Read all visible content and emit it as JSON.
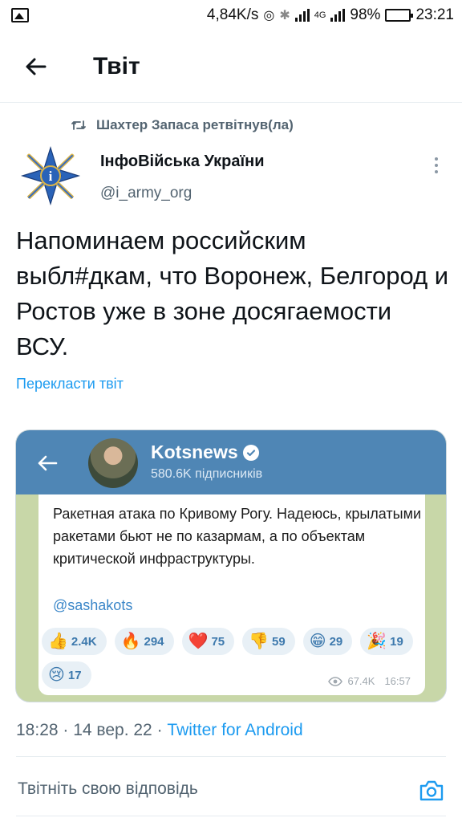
{
  "status_bar": {
    "speed": "4,84K/s",
    "network": "4G",
    "battery": "98%",
    "time": "23:21"
  },
  "header": {
    "title": "Твіт"
  },
  "tweet": {
    "retweet_text": "Шахтер Запаса ретвітнув(ла)",
    "author_name": "ІнфоВійська України",
    "author_handle": "@i_army_org",
    "text": "Напоминаем российским выбл#дкам, что Воронеж, Белгород и Ростов уже в зоне досягаемости ВСУ.",
    "translate_label": "Перекласти твіт",
    "time": "18:28",
    "date": "14 вер. 22",
    "source": "Twitter for Android"
  },
  "media": {
    "channel_name": "Kotsnews",
    "subscribers": "580.6K підписників",
    "message": "Ракетная атака по Кривому Рогу. Надеюсь, крылатыми ракетами бьют не по казармам, а по объектам критической инфраструктуры.",
    "link": "@sashakots",
    "reactions": [
      {
        "emoji": "👍",
        "count": "2.4K"
      },
      {
        "emoji": "🔥",
        "count": "294"
      },
      {
        "emoji": "❤️",
        "count": "75"
      },
      {
        "emoji": "👎",
        "count": "59"
      },
      {
        "emoji": "😁",
        "count": "29"
      },
      {
        "emoji": "🎉",
        "count": "19"
      },
      {
        "emoji": "😢",
        "count": "17"
      }
    ],
    "views": "67.4K",
    "time": "16:57"
  },
  "reply": {
    "placeholder": "Твітніть свою відповідь"
  },
  "colors": {
    "accent": "#1d9bf0",
    "secondary_text": "#536471",
    "telegram_header": "#4f86b5"
  }
}
